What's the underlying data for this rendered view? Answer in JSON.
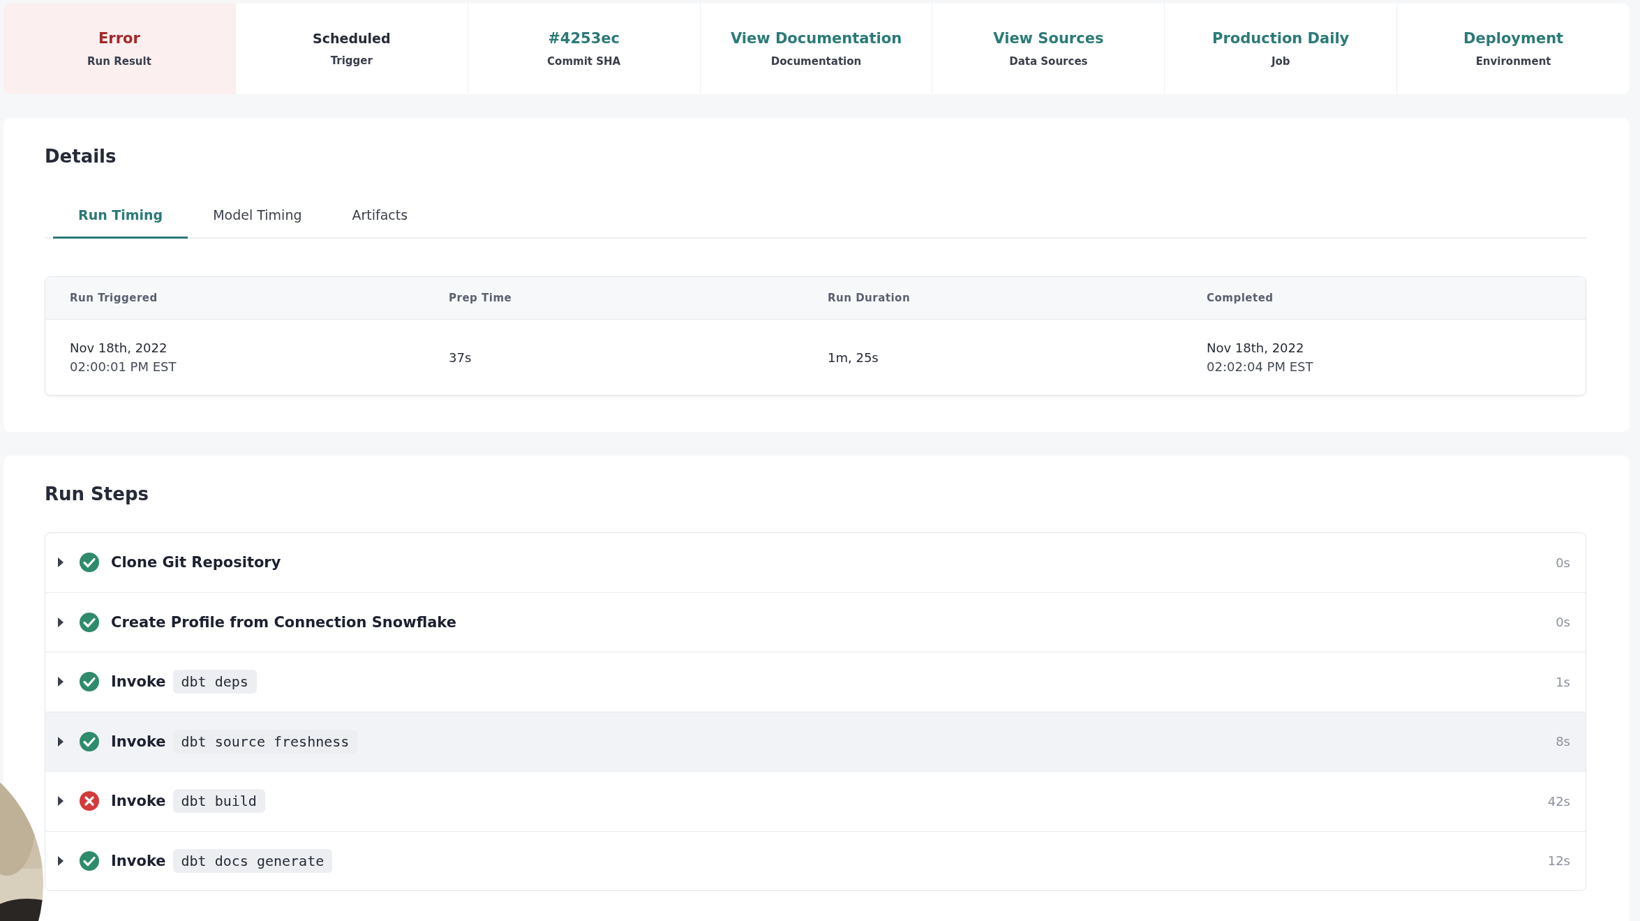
{
  "summary": [
    {
      "value": "Error",
      "label": "Run Result",
      "kind": "error"
    },
    {
      "value": "Scheduled",
      "label": "Trigger",
      "kind": "plain"
    },
    {
      "value": "#4253ec",
      "label": "Commit SHA",
      "kind": "link"
    },
    {
      "value": "View Documentation",
      "label": "Documentation",
      "kind": "link"
    },
    {
      "value": "View Sources",
      "label": "Data Sources",
      "kind": "link"
    },
    {
      "value": "Production Daily",
      "label": "Job",
      "kind": "link"
    },
    {
      "value": "Deployment",
      "label": "Environment",
      "kind": "link"
    }
  ],
  "details": {
    "title": "Details",
    "tabs": [
      {
        "label": "Run Timing",
        "selected": true
      },
      {
        "label": "Model Timing",
        "selected": false
      },
      {
        "label": "Artifacts",
        "selected": false
      }
    ],
    "timing": {
      "columns": [
        "Run Triggered",
        "Prep Time",
        "Run Duration",
        "Completed"
      ],
      "row": [
        [
          "Nov 18th, 2022",
          "02:00:01 PM EST"
        ],
        [
          "37s"
        ],
        [
          "1m, 25s"
        ],
        [
          "Nov 18th, 2022",
          "02:02:04 PM EST"
        ]
      ]
    }
  },
  "run_steps": {
    "title": "Run Steps",
    "steps": [
      {
        "label": "Clone Git Repository",
        "kind": "success",
        "duration": "0s",
        "highlighted": false
      },
      {
        "label": "Create Profile from Connection Snowflake",
        "kind": "success",
        "duration": "0s",
        "highlighted": false
      },
      {
        "label": "Invoke",
        "command": "dbt deps",
        "kind": "success",
        "duration": "1s",
        "highlighted": false
      },
      {
        "label": "Invoke",
        "command": "dbt source freshness",
        "kind": "success",
        "duration": "8s",
        "highlighted": true
      },
      {
        "label": "Invoke",
        "command": "dbt build",
        "kind": "error",
        "duration": "42s",
        "highlighted": false
      },
      {
        "label": "Invoke",
        "command": "dbt docs generate",
        "kind": "success",
        "duration": "12s",
        "highlighted": false
      }
    ]
  }
}
